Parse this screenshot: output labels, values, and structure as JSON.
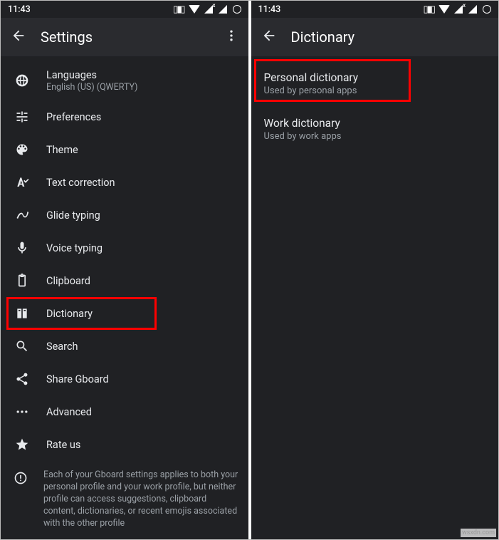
{
  "status_time": "11:43",
  "left": {
    "title": "Settings",
    "items": [
      {
        "label": "Languages",
        "sub": "English (US) (QWERTY)",
        "icon": "globe"
      },
      {
        "label": "Preferences",
        "icon": "sliders"
      },
      {
        "label": "Theme",
        "icon": "palette"
      },
      {
        "label": "Text correction",
        "icon": "textcheck"
      },
      {
        "label": "Glide typing",
        "icon": "glide"
      },
      {
        "label": "Voice typing",
        "icon": "mic"
      },
      {
        "label": "Clipboard",
        "icon": "clipboard"
      },
      {
        "label": "Dictionary",
        "icon": "book"
      },
      {
        "label": "Search",
        "icon": "search"
      },
      {
        "label": "Share Gboard",
        "icon": "share"
      },
      {
        "label": "Advanced",
        "icon": "dots"
      },
      {
        "label": "Rate us",
        "icon": "star"
      }
    ],
    "info": "Each of your Gboard settings applies to both your personal profile and your work profile, but neither profile can access suggestions, clipboard content, dictionaries, or recent emojis associated with the other profile"
  },
  "right": {
    "title": "Dictionary",
    "items": [
      {
        "label": "Personal dictionary",
        "sub": "Used by personal apps"
      },
      {
        "label": "Work dictionary",
        "sub": "Used by work apps"
      }
    ]
  },
  "watermark": "wsxdn.com"
}
